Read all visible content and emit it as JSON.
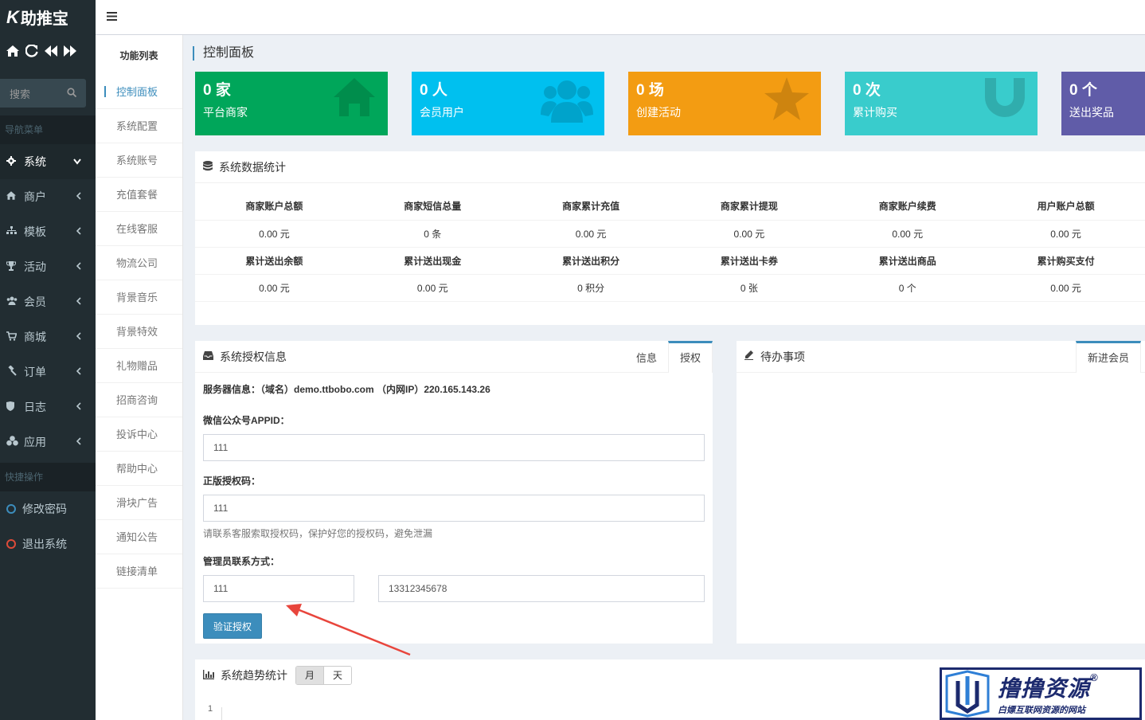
{
  "app": {
    "logo_k": "K",
    "logo_text": "助推宝"
  },
  "sidebar": {
    "search_placeholder": "搜索",
    "nav_header": "导航菜单",
    "items": [
      {
        "label": "系统",
        "icon": "gear-icon"
      },
      {
        "label": "商户",
        "icon": "home-icon"
      },
      {
        "label": "模板",
        "icon": "sitemap-icon"
      },
      {
        "label": "活动",
        "icon": "trophy-icon"
      },
      {
        "label": "会员",
        "icon": "users-icon"
      },
      {
        "label": "商城",
        "icon": "cart-icon"
      },
      {
        "label": "订单",
        "icon": "gavel-icon"
      },
      {
        "label": "日志",
        "icon": "shield-icon"
      },
      {
        "label": "应用",
        "icon": "cubes-icon"
      }
    ],
    "quick_header": "快捷操作",
    "quick_items": [
      {
        "label": "修改密码"
      },
      {
        "label": "退出系统"
      }
    ]
  },
  "funclist": {
    "title": "功能列表",
    "items": [
      "控制面板",
      "系统配置",
      "系统账号",
      "充值套餐",
      "在线客服",
      "物流公司",
      "背景音乐",
      "背景特效",
      "礼物赠品",
      "招商咨询",
      "投诉中心",
      "帮助中心",
      "滑块广告",
      "通知公告",
      "链接清单"
    ]
  },
  "main": {
    "page_title": "控制面板",
    "stats": [
      {
        "num": "0 家",
        "label": "平台商家",
        "color": "#00a65a",
        "icon": "home-icon"
      },
      {
        "num": "0 人",
        "label": "会员用户",
        "color": "#00c0ef",
        "icon": "users-icon"
      },
      {
        "num": "0 场",
        "label": "创建活动",
        "color": "#f39c12",
        "icon": "star-icon"
      },
      {
        "num": "0 次",
        "label": "累计购买",
        "color": "#39cccc",
        "icon": "magnet-icon"
      },
      {
        "num": "0 个",
        "label": "送出奖品",
        "color": "#605ca8",
        "icon": "gift-icon"
      }
    ],
    "sys_stats": {
      "title": "系统数据统计",
      "row1_heads": [
        "商家账户总额",
        "商家短信总量",
        "商家累计充值",
        "商家累计提现",
        "商家账户续费",
        "用户账户总额"
      ],
      "row1_vals": [
        "0.00 元",
        "0 条",
        "0.00 元",
        "0.00 元",
        "0.00 元",
        "0.00 元"
      ],
      "row2_heads": [
        "累计送出余额",
        "累计送出现金",
        "累计送出积分",
        "累计送出卡券",
        "累计送出商品",
        "累计购买支付"
      ],
      "row2_vals": [
        "0.00 元",
        "0.00 元",
        "0 积分",
        "0 张",
        "0 个",
        "0.00 元"
      ]
    },
    "license": {
      "title": "系统授权信息",
      "tab_info": "信息",
      "tab_auth": "授权",
      "server_info": "服务器信息：（域名）demo.ttbobo.com （内网IP）220.165.143.26",
      "appid_label": "微信公众号APPID：",
      "appid_value": "111",
      "code_label": "正版授权码：",
      "code_value": "111",
      "code_hint": "请联系客服索取授权码，保护好您的授权码，避免泄漏",
      "contact_label": "管理员联系方式：",
      "contact_name": "111",
      "contact_phone": "13312345678",
      "verify_button": "验证授权"
    },
    "todo": {
      "title": "待办事项",
      "tab": "新进会员"
    },
    "trend": {
      "title": "系统趋势统计",
      "month": "月",
      "day": "天",
      "y_tick": "1"
    }
  },
  "watermark": {
    "big": "撸撸资源",
    "small": "白嫖互联网资源的网站",
    "reg": "®"
  }
}
